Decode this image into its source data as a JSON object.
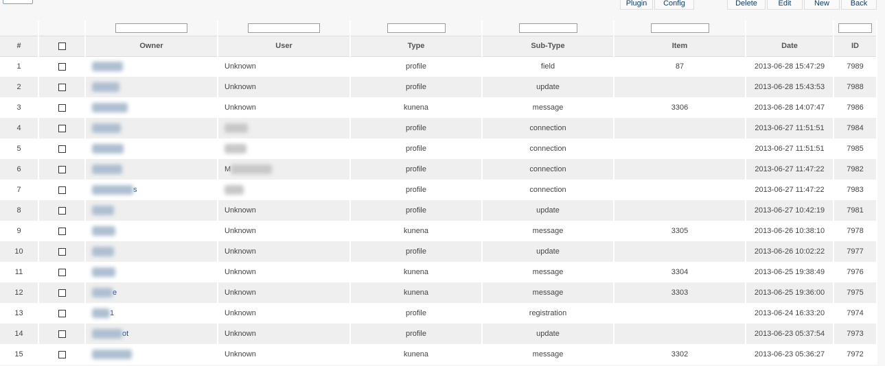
{
  "toolbar": {
    "plugin": "Plugin",
    "config": "Config",
    "delete": "Delete",
    "edit": "Edit",
    "new": "New",
    "back": "Back"
  },
  "columns": {
    "num": "#",
    "owner": "Owner",
    "user": "User",
    "type": "Type",
    "subtype": "Sub-Type",
    "item": "Item",
    "date": "Date",
    "id": "ID"
  },
  "rows": [
    {
      "num": "1",
      "owner": "",
      "user": "Unknown",
      "type": "profile",
      "subtype": "field",
      "item": "87",
      "date": "2013-06-28 15:47:29",
      "id": "7989"
    },
    {
      "num": "2",
      "owner": "",
      "user": "Unknown",
      "type": "profile",
      "subtype": "update",
      "item": "",
      "date": "2013-06-28 15:43:53",
      "id": "7988"
    },
    {
      "num": "3",
      "owner": "",
      "user": "Unknown",
      "type": "kunena",
      "subtype": "message",
      "item": "3306",
      "date": "2013-06-28 14:07:47",
      "id": "7986"
    },
    {
      "num": "4",
      "owner": "",
      "user": "",
      "type": "profile",
      "subtype": "connection",
      "item": "",
      "date": "2013-06-27 11:51:51",
      "id": "7984"
    },
    {
      "num": "5",
      "owner": "",
      "user": "",
      "type": "profile",
      "subtype": "connection",
      "item": "",
      "date": "2013-06-27 11:51:51",
      "id": "7985"
    },
    {
      "num": "6",
      "owner": "",
      "user": "M",
      "type": "profile",
      "subtype": "connection",
      "item": "",
      "date": "2013-06-27 11:47:22",
      "id": "7982"
    },
    {
      "num": "7",
      "owner": "s",
      "user": "",
      "type": "profile",
      "subtype": "connection",
      "item": "",
      "date": "2013-06-27 11:47:22",
      "id": "7983"
    },
    {
      "num": "8",
      "owner": "",
      "user": "Unknown",
      "type": "profile",
      "subtype": "update",
      "item": "",
      "date": "2013-06-27 10:42:19",
      "id": "7981"
    },
    {
      "num": "9",
      "owner": "",
      "user": "Unknown",
      "type": "kunena",
      "subtype": "message",
      "item": "3305",
      "date": "2013-06-26 10:38:10",
      "id": "7978"
    },
    {
      "num": "10",
      "owner": "",
      "user": "Unknown",
      "type": "profile",
      "subtype": "update",
      "item": "",
      "date": "2013-06-26 10:02:22",
      "id": "7977"
    },
    {
      "num": "11",
      "owner": "",
      "user": "Unknown",
      "type": "kunena",
      "subtype": "message",
      "item": "3304",
      "date": "2013-06-25 19:38:49",
      "id": "7976"
    },
    {
      "num": "12",
      "owner": "e",
      "user": "Unknown",
      "type": "kunena",
      "subtype": "message",
      "item": "3303",
      "date": "2013-06-25 19:36:00",
      "id": "7975"
    },
    {
      "num": "13",
      "owner": "1",
      "user": "Unknown",
      "type": "profile",
      "subtype": "registration",
      "item": "",
      "date": "2013-06-24 16:33:20",
      "id": "7974"
    },
    {
      "num": "14",
      "owner": "ot",
      "user": "Unknown",
      "type": "profile",
      "subtype": "update",
      "item": "",
      "date": "2013-06-23 05:37:54",
      "id": "7973"
    },
    {
      "num": "15",
      "owner": "",
      "user": "Unknown",
      "type": "kunena",
      "subtype": "message",
      "item": "3302",
      "date": "2013-06-23 05:36:27",
      "id": "7972"
    }
  ]
}
